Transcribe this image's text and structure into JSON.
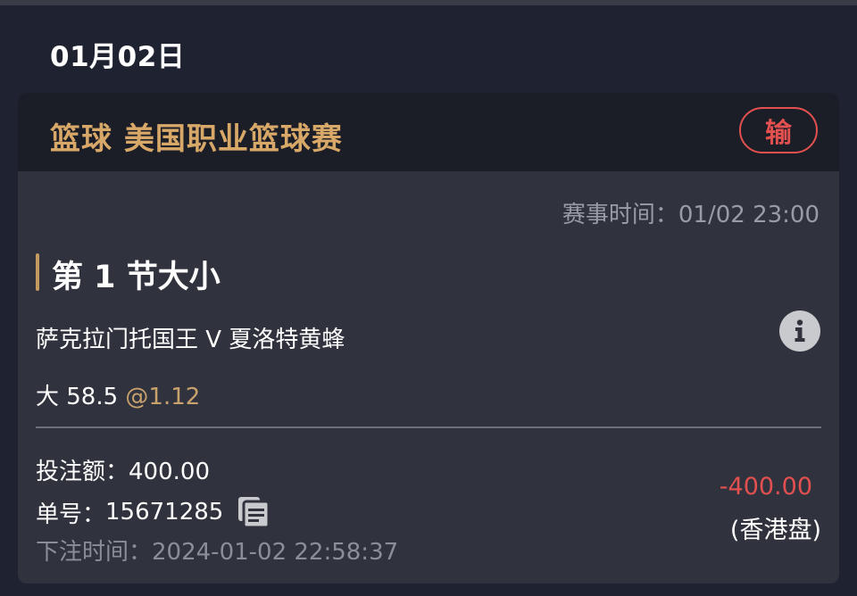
{
  "date": "01月02日",
  "card": {
    "league": "篮球 美国职业篮球赛",
    "result": "输",
    "match_time_label": "赛事时间：",
    "match_time": "01/02 23:00",
    "market": "第 1 节大小",
    "teams": "萨克拉门托国王 V 夏洛特黄蜂",
    "pick": "大 58.5",
    "odds": "@1.12",
    "stake_label": "投注额：",
    "stake": "400.00",
    "order_label": "单号：",
    "order_no": "15671285",
    "bet_time_label": "下注时间：",
    "bet_time": "2024-01-02 22:58:37",
    "payout": "-400.00",
    "odds_type": "(香港盘)"
  },
  "colors": {
    "accent_gold": "#d8a868",
    "loss_red": "#e2504f"
  },
  "icons": [
    "info-icon",
    "copy-icon"
  ]
}
